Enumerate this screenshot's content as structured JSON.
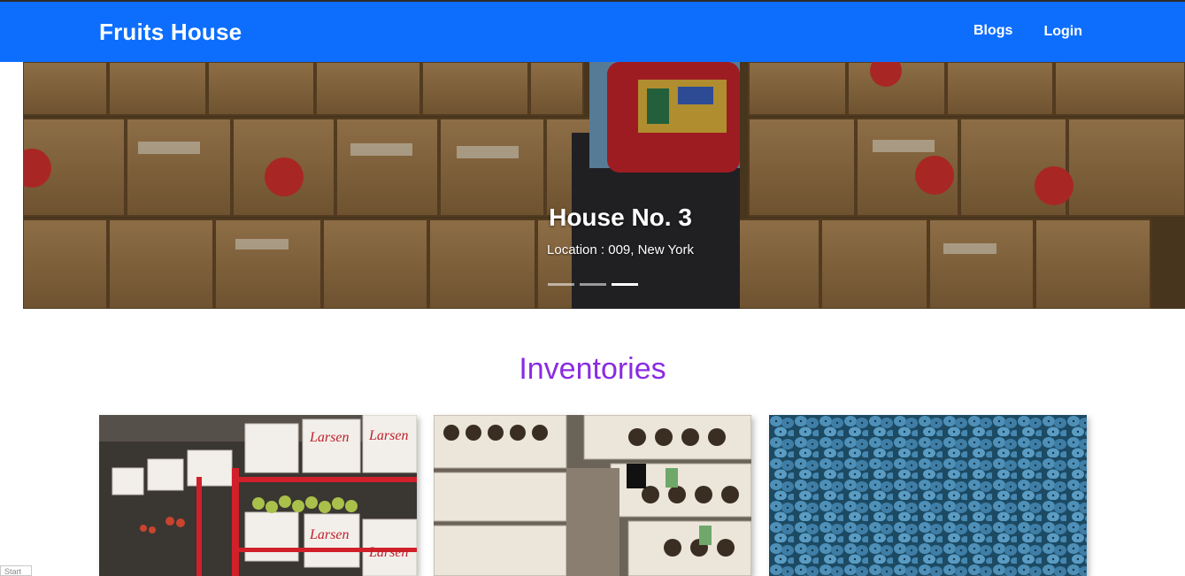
{
  "navbar": {
    "brand": "Fruits House",
    "links": [
      {
        "label": "Blogs"
      },
      {
        "label": "Login"
      }
    ],
    "background_color": "#0d6efd"
  },
  "hero": {
    "title": "House No. 3",
    "location": "Location : 009, New York",
    "slide_count": 3,
    "active_slide": 3
  },
  "inventories": {
    "heading": "Inventories",
    "heading_color": "#8a2be2",
    "cards": [
      {
        "image": "larsen-fancy-apples-shelves"
      },
      {
        "image": "stacked-jars-warehouse"
      },
      {
        "image": "blueberries"
      }
    ]
  },
  "taskbar": {
    "start_label": "Start"
  }
}
